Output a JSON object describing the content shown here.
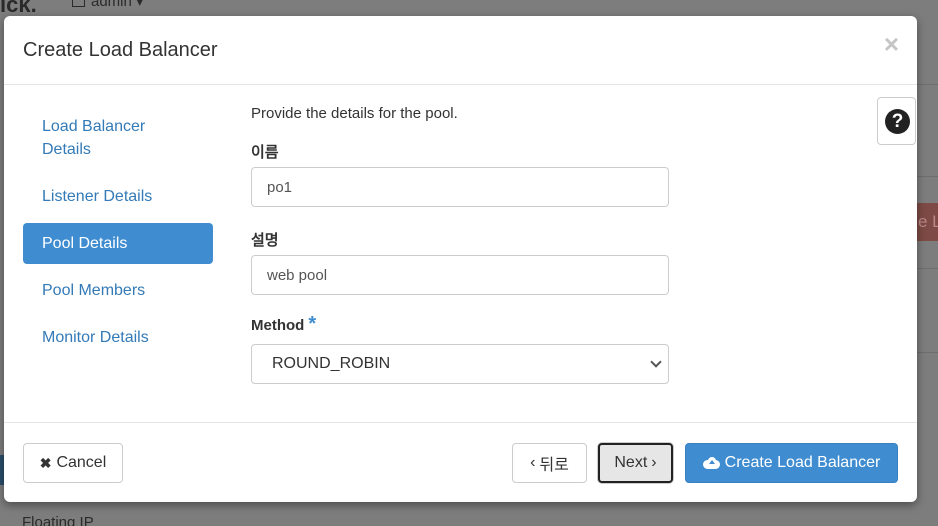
{
  "background": {
    "brand": "ick.",
    "user": "admin ▾",
    "right_button_text": "e L",
    "floating_ip": "Floating IP"
  },
  "modal": {
    "title": "Create Load Balancer",
    "close_glyph": "×"
  },
  "nav": {
    "items": [
      {
        "label": "Load Balancer Details",
        "active": false
      },
      {
        "label": "Listener Details",
        "active": false
      },
      {
        "label": "Pool Details",
        "active": true
      },
      {
        "label": "Pool Members",
        "active": false
      },
      {
        "label": "Monitor Details",
        "active": false
      }
    ]
  },
  "help": {
    "glyph": "?"
  },
  "form": {
    "intro": "Provide the details for the pool.",
    "name_label": "이름",
    "name_value": "po1",
    "description_label": "설명",
    "description_value": "web pool",
    "method_label": "Method",
    "method_required": "*",
    "method_value": "ROUND_ROBIN"
  },
  "footer": {
    "cancel_label": "Cancel",
    "cancel_icon": "✖",
    "back_label": "뒤로",
    "back_icon": "‹",
    "next_label": "Next",
    "next_icon": "›",
    "create_label": "Create Load Balancer"
  }
}
